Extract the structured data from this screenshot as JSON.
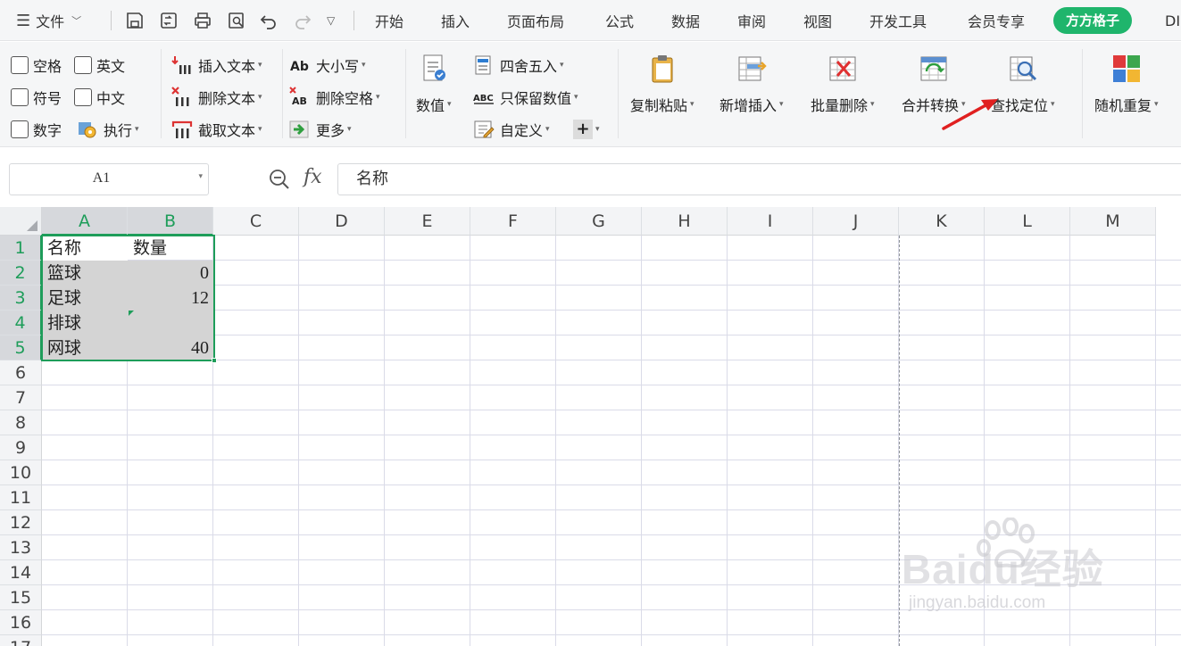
{
  "menubar": {
    "file_label": "文件",
    "tabs": [
      "开始",
      "插入",
      "页面布局",
      "公式",
      "数据",
      "审阅",
      "视图",
      "开发工具",
      "会员专享"
    ],
    "active_plugin_tab": "方方格子",
    "overflow_tab": "DI"
  },
  "ribbon": {
    "checkboxes": {
      "space": "空格",
      "english": "英文",
      "symbol": "符号",
      "chinese": "中文",
      "number": "数字"
    },
    "execute": "执行",
    "text_group": {
      "insert": "插入文本",
      "delete": "删除文本",
      "extract": "截取文本"
    },
    "case_group": {
      "case": "大小写",
      "delete_space": "删除空格",
      "more": "更多"
    },
    "numeric": "数值",
    "round_group": {
      "round": "四舍五入",
      "keep_numbers": "只保留数值",
      "custom": "自定义"
    },
    "big_buttons": [
      "复制粘贴",
      "新增插入",
      "批量删除",
      "合并转换",
      "查找定位",
      "随机重复"
    ]
  },
  "formula_bar": {
    "cell_ref": "A1",
    "fx": "fx",
    "content": "名称"
  },
  "grid": {
    "columns": [
      "A",
      "B",
      "C",
      "D",
      "E",
      "F",
      "G",
      "H",
      "I",
      "J",
      "K",
      "L",
      "M"
    ],
    "rows": [
      "1",
      "2",
      "3",
      "4",
      "5",
      "6",
      "7",
      "8",
      "9",
      "10",
      "11",
      "12",
      "13",
      "14",
      "15",
      "16",
      "17"
    ],
    "cells": {
      "A1": "名称",
      "B1": "数量",
      "A2": "篮球",
      "B2": "0",
      "A3": "足球",
      "B3": "12",
      "A4": "排球",
      "B4": "",
      "A5": "网球",
      "B5": "40"
    }
  },
  "colors": {
    "accent_green": "#1e9d5a",
    "plugin_tab_green": "#1fb56c",
    "annotation_red": "#e02020"
  },
  "watermark": {
    "brand": "Baidu经验",
    "url": "jingyan.baidu.com"
  }
}
